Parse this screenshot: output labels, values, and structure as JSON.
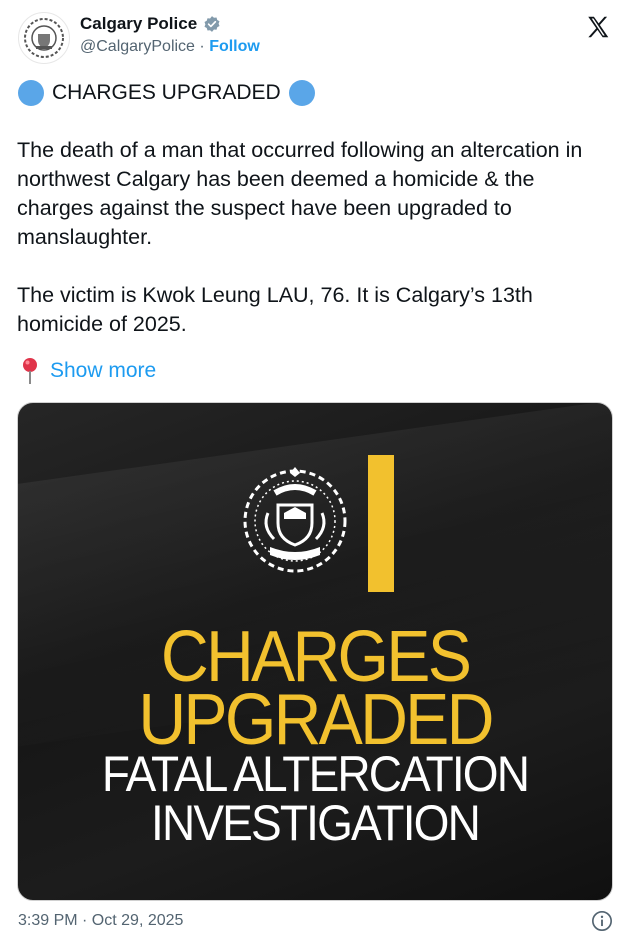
{
  "header": {
    "display_name": "Calgary Police",
    "handle": "@CalgaryPolice",
    "separator": "·",
    "follow_label": "Follow"
  },
  "icons": {
    "avatar": "calgary-police-crest-icon",
    "verified": "verified-badge-icon",
    "platform": "x-logo-icon",
    "pin": "round-pushpin-icon",
    "info": "info-circle-icon",
    "title_decoration": "blue-circle-emoji"
  },
  "post": {
    "title": "CHARGES UPGRADED",
    "paragraphs": [
      "The death of a man that occurred following an altercation in northwest Calgary has been deemed a homicide & the charges against the suspect have been upgraded to manslaughter.",
      "The victim is Kwok Leung LAU, 76. It is Calgary’s 13th homicide of 2025."
    ],
    "show_more": "Show more"
  },
  "media": {
    "line1": "CHARGES",
    "line2": "UPGRADED",
    "line3": "FATAL ALTERCATION",
    "line4": "INVESTIGATION"
  },
  "footer": {
    "timestamp": "3:39 PM · Oct 29, 2025"
  },
  "colors": {
    "link_blue": "#1d9bf0",
    "emoji_blue": "#5aa6e8",
    "banner_yellow": "#f2c12e",
    "banner_background": "#1a1a1a",
    "secondary_text": "#536471"
  }
}
